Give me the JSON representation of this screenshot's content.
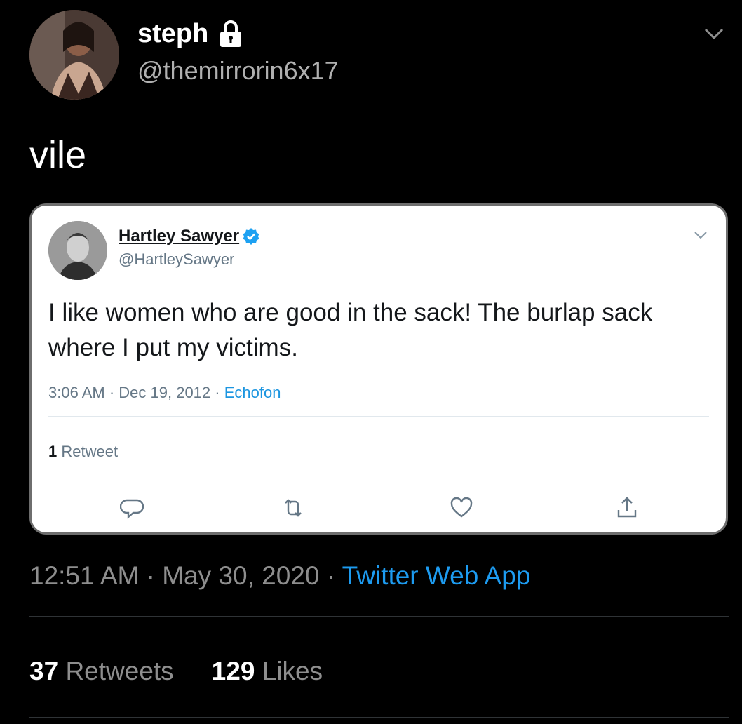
{
  "tweet": {
    "author_name": "steph",
    "author_handle": "@themirrorin6x17",
    "text": "vile",
    "time": "12:51 AM",
    "date": "May 30, 2020",
    "source": "Twitter Web App",
    "retweets_count": "37",
    "retweets_label": "Retweets",
    "likes_count": "129",
    "likes_label": "Likes",
    "lock_icon": "lock-icon",
    "caret_icon": "chevron-down-icon"
  },
  "quoted_tweet": {
    "author_name": "Hartley Sawyer",
    "author_handle": "@HartleySawyer",
    "text": "I like women who are good in the sack! The burlap sack where I put my victims.",
    "time": "3:06 AM",
    "date": "Dec 19, 2012",
    "source": "Echofon",
    "retweet_count": "1",
    "retweet_label": "Retweet",
    "verified_icon": "verified-icon",
    "verified_color": "#1da1f2",
    "actions": [
      "reply-icon",
      "retweet-icon",
      "like-icon",
      "share-icon"
    ]
  },
  "colors": {
    "background": "#000000",
    "link": "#1d9bf0",
    "muted": "#8e8e8e"
  }
}
